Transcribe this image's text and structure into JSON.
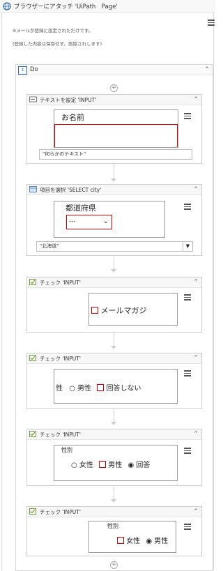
{
  "outer": {
    "title": "ブラウザーにアタッチ 'UiPath　Page'",
    "note_line1": "※メールが登録に設定されただけです。",
    "note_line2": "(登録した内容は保存せず、削除されします)"
  },
  "do": {
    "label": "Do"
  },
  "cards": [
    {
      "title": "テキストを設定 'INPUT'",
      "shot_label": "お名前",
      "field_value": "\"何らかのテキスト\""
    },
    {
      "title": "項目を選択 'SELECT  city'",
      "shot_label": "都道府県",
      "select_value": "---",
      "field_value": "\"北海道\""
    },
    {
      "title": "チェック 'INPUT'",
      "shot_text": "メールマガジ"
    },
    {
      "title": "チェック 'INPUT'",
      "shot_left": "性",
      "radio_male": "男性",
      "checkbox_label": "回答しない"
    },
    {
      "title": "チェック 'INPUT'",
      "shot_heading": "性別",
      "radio_female": "女性",
      "checkbox_label": "男性",
      "radio_other": "回答"
    },
    {
      "title": "チェック 'INPUT'",
      "shot_heading": "性別",
      "checkbox_label": "女性",
      "radio_male": "男性"
    }
  ]
}
